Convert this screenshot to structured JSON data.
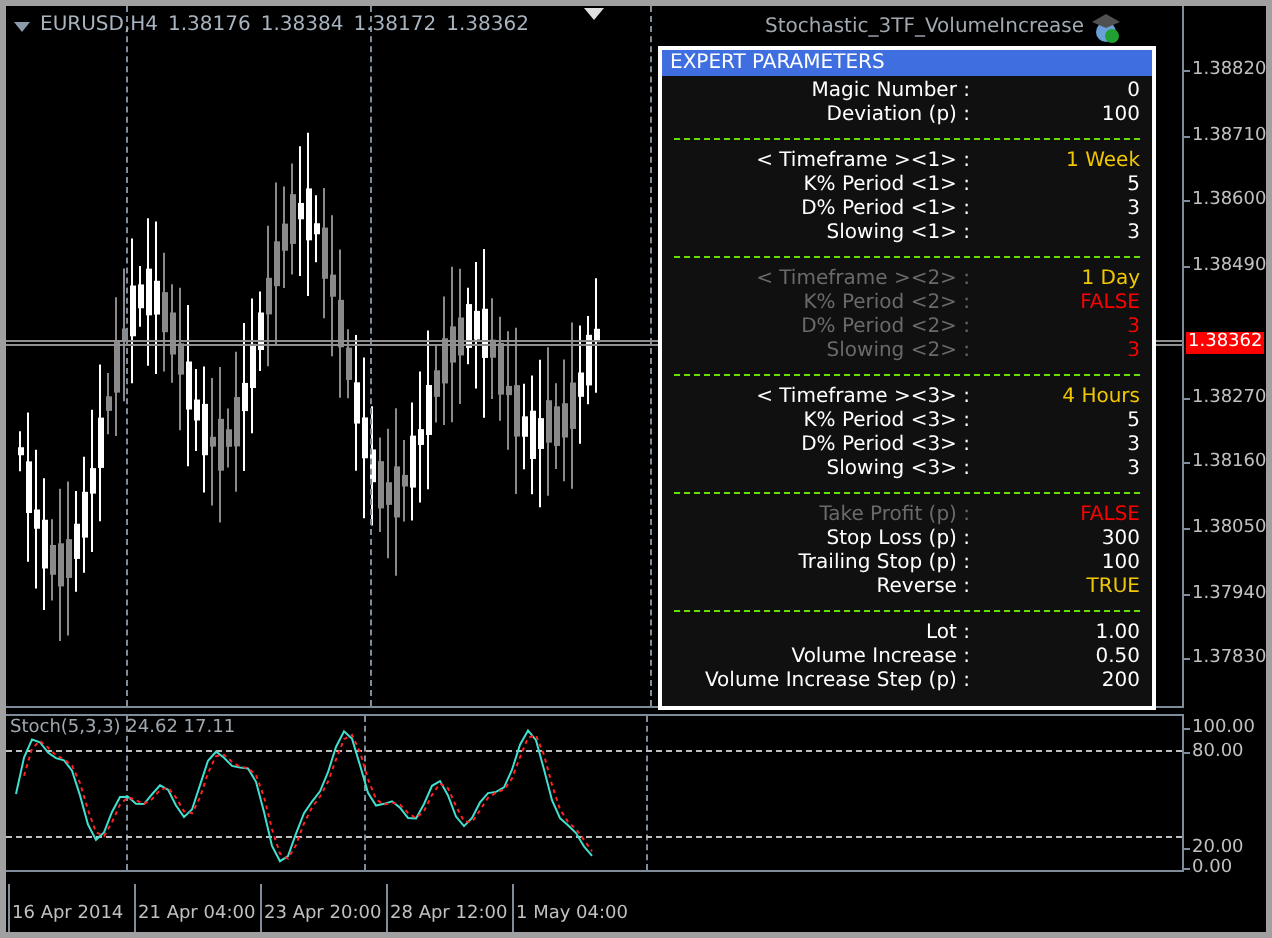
{
  "chart": {
    "symbol": "EURUSD,H4",
    "quotes": [
      "1.38176",
      "1.38384",
      "1.38172",
      "1.38362"
    ],
    "expert_name": "Stochastic_3TF_VolumeIncrease",
    "price_axis": [
      "1.38820",
      "1.38710",
      "1.38600",
      "1.38490",
      "1.38270",
      "1.38160",
      "1.38050",
      "1.37940",
      "1.37830"
    ],
    "current_price": "1.38362"
  },
  "panel": {
    "title": "EXPERT  PARAMETERS",
    "sections": [
      {
        "rows": [
          {
            "label": "Magic Number :",
            "value": "0",
            "disabled": false,
            "color": "#ffffff"
          },
          {
            "label": "Deviation (p) :",
            "value": "100",
            "disabled": false,
            "color": "#ffffff"
          }
        ]
      },
      {
        "rows": [
          {
            "label": "< Timeframe ><1> :",
            "value": "1 Week",
            "disabled": false,
            "color": "#f0c800"
          },
          {
            "label": "K% Period <1> :",
            "value": "5",
            "disabled": false,
            "color": "#ffffff"
          },
          {
            "label": "D% Period <1> :",
            "value": "3",
            "disabled": false,
            "color": "#ffffff"
          },
          {
            "label": "Slowing <1> :",
            "value": "3",
            "disabled": false,
            "color": "#ffffff"
          }
        ]
      },
      {
        "rows": [
          {
            "label": "< Timeframe ><2> :",
            "value": "1 Day",
            "disabled": true,
            "color": "#f0c800"
          },
          {
            "label": "K% Period <2> :",
            "value": "FALSE",
            "disabled": true,
            "color": "#ff0000"
          },
          {
            "label": "D% Period <2> :",
            "value": "3",
            "disabled": true,
            "color": "#ff0000"
          },
          {
            "label": "Slowing <2> :",
            "value": "3",
            "disabled": true,
            "color": "#ff0000"
          }
        ]
      },
      {
        "rows": [
          {
            "label": "< Timeframe ><3> :",
            "value": "4 Hours",
            "disabled": false,
            "color": "#f0c800"
          },
          {
            "label": "K% Period <3> :",
            "value": "5",
            "disabled": false,
            "color": "#ffffff"
          },
          {
            "label": "D% Period <3> :",
            "value": "3",
            "disabled": false,
            "color": "#ffffff"
          },
          {
            "label": "Slowing <3> :",
            "value": "3",
            "disabled": false,
            "color": "#ffffff"
          }
        ]
      },
      {
        "rows": [
          {
            "label": "Take Profit (p) :",
            "value": "FALSE",
            "disabled": true,
            "color": "#ff0000"
          },
          {
            "label": "Stop Loss (p) :",
            "value": "300",
            "disabled": false,
            "color": "#ffffff"
          },
          {
            "label": "Trailing Stop (p) :",
            "value": "100",
            "disabled": false,
            "color": "#ffffff"
          },
          {
            "label": "Reverse :",
            "value": "TRUE",
            "disabled": false,
            "color": "#f0c800"
          }
        ]
      },
      {
        "rows": [
          {
            "label": "Lot :",
            "value": "1.00",
            "disabled": false,
            "color": "#ffffff"
          },
          {
            "label": "Volume Increase :",
            "value": "0.50",
            "disabled": false,
            "color": "#ffffff"
          },
          {
            "label": "Volume Increase Step (p) :",
            "value": "200",
            "disabled": false,
            "color": "#ffffff"
          }
        ]
      }
    ]
  },
  "indicator": {
    "label": "Stoch(5,3,3) 24.62 17.11",
    "axis": [
      "100.00",
      "80.00",
      "20.00",
      "0.00"
    ]
  },
  "time_axis": [
    "16 Apr 2014",
    "21 Apr 04:00",
    "23 Apr 20:00",
    "28 Apr 12:00",
    "1 May 04:00"
  ]
}
